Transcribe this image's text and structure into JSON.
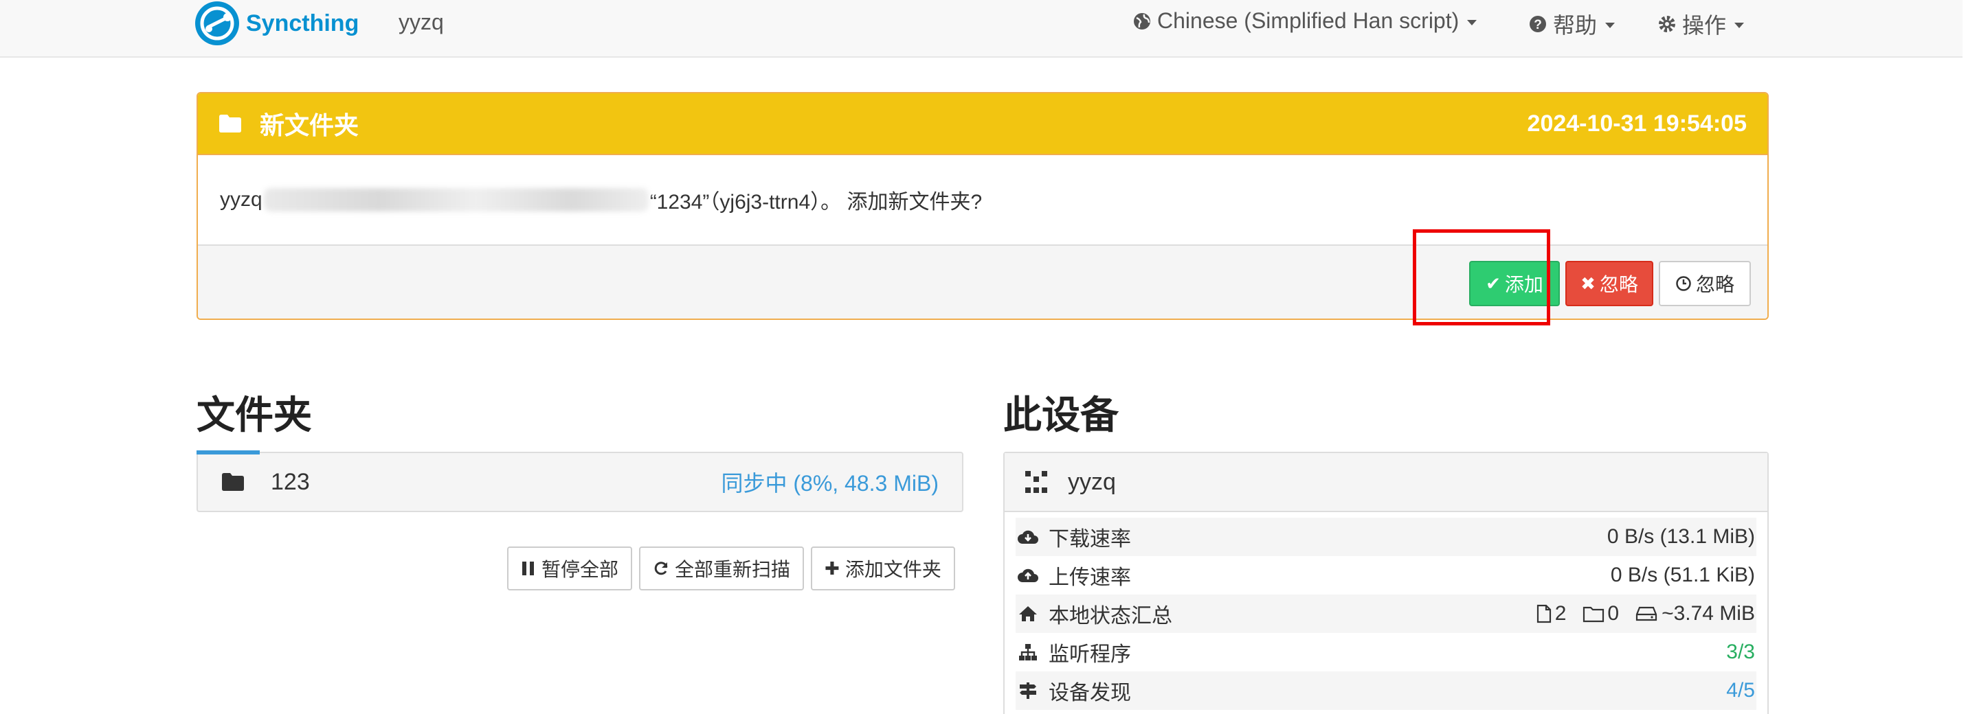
{
  "navbar": {
    "brand": "Syncthing",
    "device_name": "yyzq",
    "language": "Chinese (Simplified Han script)",
    "help": "帮助",
    "actions": "操作"
  },
  "notice": {
    "title": "新文件夹",
    "timestamp": "2024-10-31 19:54:05",
    "message_prefix": "yyzq",
    "message_suffix": "“1234”（yj6j3-ttrn4）。 添加新文件夹?",
    "add_label": "添加",
    "ignore_label": "忽略",
    "ignore_later_label": "忽略"
  },
  "folders": {
    "title": "文件夹",
    "items": [
      {
        "name": "123",
        "status": "同步中 (8%, 48.3 MiB)"
      }
    ],
    "pause_all": "暂停全部",
    "rescan_all": "全部重新扫描",
    "add_folder": "添加文件夹"
  },
  "this_device": {
    "title": "此设备",
    "name": "yyzq",
    "rows": {
      "download_label": "下载速率",
      "download_value": "0 B/s (13.1 MiB)",
      "upload_label": "上传速率",
      "upload_value": "0 B/s (51.1 KiB)",
      "local_state_label": "本地状态汇总",
      "files": "2",
      "dirs": "0",
      "size": "~3.74 MiB",
      "listeners_label": "监听程序",
      "listeners_value": "3/3",
      "discovery_label": "设备发现",
      "discovery_value": "4/5"
    }
  },
  "colors": {
    "brand": "#0891d1",
    "notice_header": "#f2c511",
    "success": "#2ecc71",
    "danger": "#e74c3c",
    "link": "#3a9ad9",
    "highlight": "#ee0000"
  }
}
